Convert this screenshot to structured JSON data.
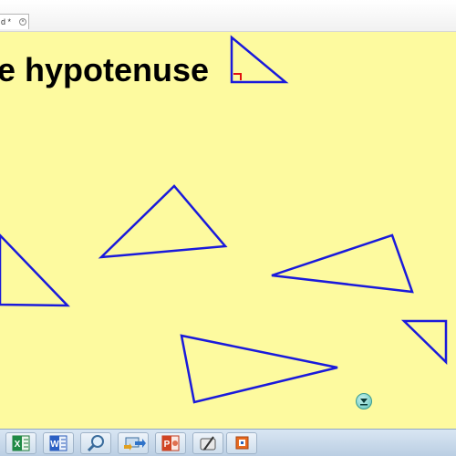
{
  "tab": {
    "label": "d *",
    "close_glyph": "×"
  },
  "slide": {
    "title": "e hypotenuse"
  },
  "taskbar": {
    "items": [
      {
        "name": "excel-icon",
        "label": "X"
      },
      {
        "name": "word-icon",
        "label": "W"
      },
      {
        "name": "search-icon"
      },
      {
        "name": "network-transfer-icon"
      },
      {
        "name": "powerpoint-icon",
        "label": "P"
      },
      {
        "name": "pen-tablet-icon"
      },
      {
        "name": "camtasia-icon"
      }
    ]
  },
  "colors": {
    "background": "#fdfa9f",
    "triangle_stroke": "#1a1adb",
    "right_angle_marker": "#e01010"
  }
}
